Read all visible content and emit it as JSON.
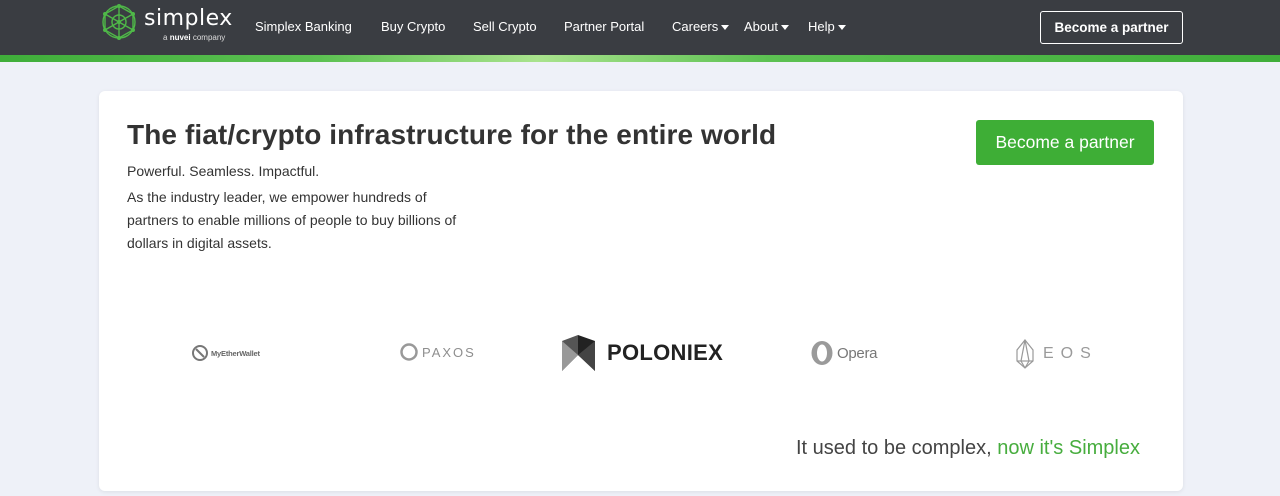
{
  "brand": {
    "name": "simplex",
    "tagline_prefix": "a",
    "tagline_company": "nuvei",
    "tagline_suffix": "company"
  },
  "nav": {
    "links": [
      {
        "label": "Simplex Banking",
        "dropdown": false
      },
      {
        "label": "Buy Crypto",
        "dropdown": false
      },
      {
        "label": "Sell Crypto",
        "dropdown": false
      },
      {
        "label": "Partner Portal",
        "dropdown": false
      },
      {
        "label": "Careers",
        "dropdown": true
      },
      {
        "label": "About",
        "dropdown": true
      },
      {
        "label": "Help",
        "dropdown": true
      }
    ],
    "cta_label": "Become a partner"
  },
  "hero": {
    "headline": "The fiat/crypto infrastructure for the entire world",
    "tagline": "Powerful. Seamless. Impactful.",
    "description": "As the industry leader, we empower hundreds of partners to enable millions of people to buy billions of dollars in digital assets.",
    "cta_label": "Become a partner"
  },
  "partners": [
    {
      "name": "MyEtherWallet",
      "icon": "myetherwallet-icon"
    },
    {
      "name": "PAXOS",
      "icon": "paxos-icon"
    },
    {
      "name": "POLONIEX",
      "icon": "poloniex-icon"
    },
    {
      "name": "Opera",
      "icon": "opera-icon"
    },
    {
      "name": "EOS",
      "icon": "eos-icon"
    }
  ],
  "footline": {
    "prefix": "It used to be complex,",
    "accent": "now it's Simplex"
  },
  "colors": {
    "nav_bg": "#3a3d42",
    "brand_green": "#3eae36",
    "page_bg": "#eef1f8"
  }
}
